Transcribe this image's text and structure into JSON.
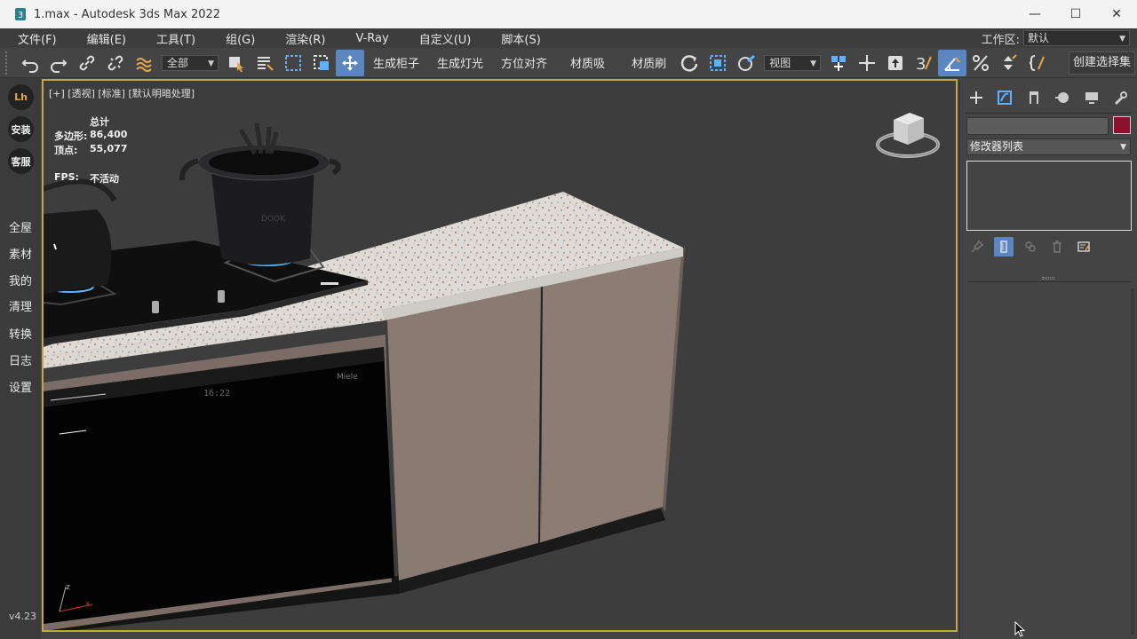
{
  "window": {
    "title": "1.max - Autodesk 3ds Max 2022",
    "minimize": "—",
    "maximize": "☐",
    "close": "✕"
  },
  "menu": {
    "items": [
      "文件(F)",
      "编辑(E)",
      "工具(T)",
      "组(G)",
      "渲染(R)",
      "V-Ray",
      "自定义(U)",
      "脚本(S)"
    ],
    "workspace_label": "工作区:",
    "workspace_value": "默认"
  },
  "toolbar": {
    "selection_filter": "全部",
    "btn_cabinet": "生成柜子",
    "btn_light": "生成灯光",
    "btn_align": "方位对齐",
    "btn_mat_pick": "材质吸",
    "btn_mat_brush": "材质刷",
    "ref_coord": "视图",
    "create_selection_set": "创建选择集"
  },
  "leftstrip": {
    "lh": "Lh",
    "install": "安装",
    "service": "客服",
    "items": [
      "全屋",
      "素材",
      "我的",
      "清理",
      "转换",
      "日志",
      "设置"
    ],
    "version": "v4.23"
  },
  "viewport": {
    "label": "[+] [透视] [标准] [默认明暗处理]",
    "stats_header": "总计",
    "polys_label": "多边形:",
    "polys_value": "86,400",
    "verts_label": "顶点:",
    "verts_value": "55,077",
    "fps_label": "FPS:",
    "fps_value": "不活动",
    "oven_time": "16:22",
    "oven_brand": "Miele",
    "pot_text": "DOOK"
  },
  "cmdpanel": {
    "modifier_list": "修改器列表",
    "object_color": "#8a1230"
  },
  "colors": {
    "viewport_border": "#c8a54a",
    "active_blue": "#5b86c0"
  }
}
